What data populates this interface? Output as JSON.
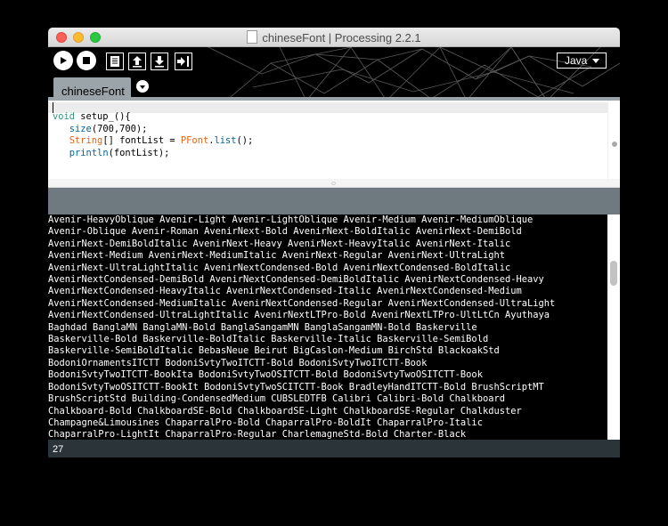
{
  "window": {
    "title": "chineseFont | Processing 2.2.1"
  },
  "toolbar": {
    "run_tooltip_icon": "play-icon",
    "stop_icon": "stop-icon",
    "mode": "Java"
  },
  "tabs": [
    {
      "label": "chineseFont"
    }
  ],
  "editor": {
    "lines": [
      "void setup_(){",
      "   size(700,700);",
      "   String[] fontList = PFont.list();",
      "   println(fontList);"
    ]
  },
  "console": {
    "lines": [
      "Avenir-HeavyOblique Avenir-Light Avenir-LightOblique Avenir-Medium Avenir-MediumOblique",
      "Avenir-Oblique Avenir-Roman AvenirNext-Bold AvenirNext-BoldItalic AvenirNext-DemiBold",
      "AvenirNext-DemiBoldItalic AvenirNext-Heavy AvenirNext-HeavyItalic AvenirNext-Italic",
      "AvenirNext-Medium AvenirNext-MediumItalic AvenirNext-Regular AvenirNext-UltraLight",
      "AvenirNext-UltraLightItalic AvenirNextCondensed-Bold AvenirNextCondensed-BoldItalic",
      "AvenirNextCondensed-DemiBold AvenirNextCondensed-DemiBoldItalic AvenirNextCondensed-Heavy",
      "AvenirNextCondensed-HeavyItalic AvenirNextCondensed-Italic AvenirNextCondensed-Medium",
      "AvenirNextCondensed-MediumItalic AvenirNextCondensed-Regular AvenirNextCondensed-UltraLight",
      "AvenirNextCondensed-UltraLightItalic AvenirNextLTPro-Bold AvenirNextLTPro-UltLtCn Ayuthaya",
      "Baghdad BanglaMN BanglaMN-Bold BanglaSangamMN BanglaSangamMN-Bold Baskerville",
      "Baskerville-Bold Baskerville-BoldItalic Baskerville-Italic Baskerville-SemiBold",
      "Baskerville-SemiBoldItalic BebasNeue Beirut BigCaslon-Medium BirchStd BlackoakStd",
      "BodoniOrnamentsITCTT BodoniSvtyTwoITCTT-Bold BodoniSvtyTwoITCTT-Book",
      "BodoniSvtyTwoITCTT-BookIta BodoniSvtyTwoOSITCTT-Bold BodoniSvtyTwoOSITCTT-Book",
      "BodoniSvtyTwoOSITCTT-BookIt BodoniSvtyTwoSCITCTT-Book BradleyHandITCTT-Bold BrushScriptMT",
      "BrushScriptStd Building-CondensedMedium CUBSLEDTFB Calibri Calibri-Bold Chalkboard",
      "Chalkboard-Bold ChalkboardSE-Bold ChalkboardSE-Light ChalkboardSE-Regular Chalkduster",
      "Champagne&Limousines ChaparralPro-Bold ChaparralPro-BoldIt ChaparralPro-Italic",
      "ChaparralPro-LightIt ChaparralPro-Regular CharlemagneStd-Bold Charter-Black"
    ]
  },
  "status": {
    "line_number": "27"
  },
  "colors": {
    "tab_bg": "#9ba4a8",
    "message_bg": "#6f7a80",
    "status_bg": "#2b3438",
    "keyword_void": "#33997e",
    "keyword_function": "#006699",
    "keyword_type": "#e2661a"
  }
}
